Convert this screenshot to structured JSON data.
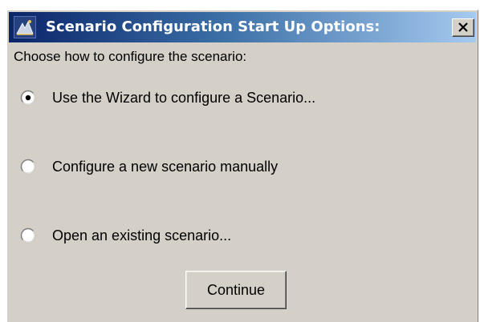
{
  "window": {
    "title": "Scenario Configuration Start Up Options:",
    "icon": "scenario-app-icon",
    "close_icon": "close-icon"
  },
  "prompt": "Choose how to configure the scenario:",
  "options": [
    {
      "label": "Use the Wizard to configure a Scenario...",
      "selected": true
    },
    {
      "label": "Configure a new scenario manually",
      "selected": false
    },
    {
      "label": "Open an existing scenario...",
      "selected": false
    }
  ],
  "continue_label": "Continue",
  "colors": {
    "dialog_bg": "#d4d0c8",
    "titlebar_start": "#0a246a",
    "titlebar_end": "#a6caf0",
    "title_text": "#ffffff"
  }
}
